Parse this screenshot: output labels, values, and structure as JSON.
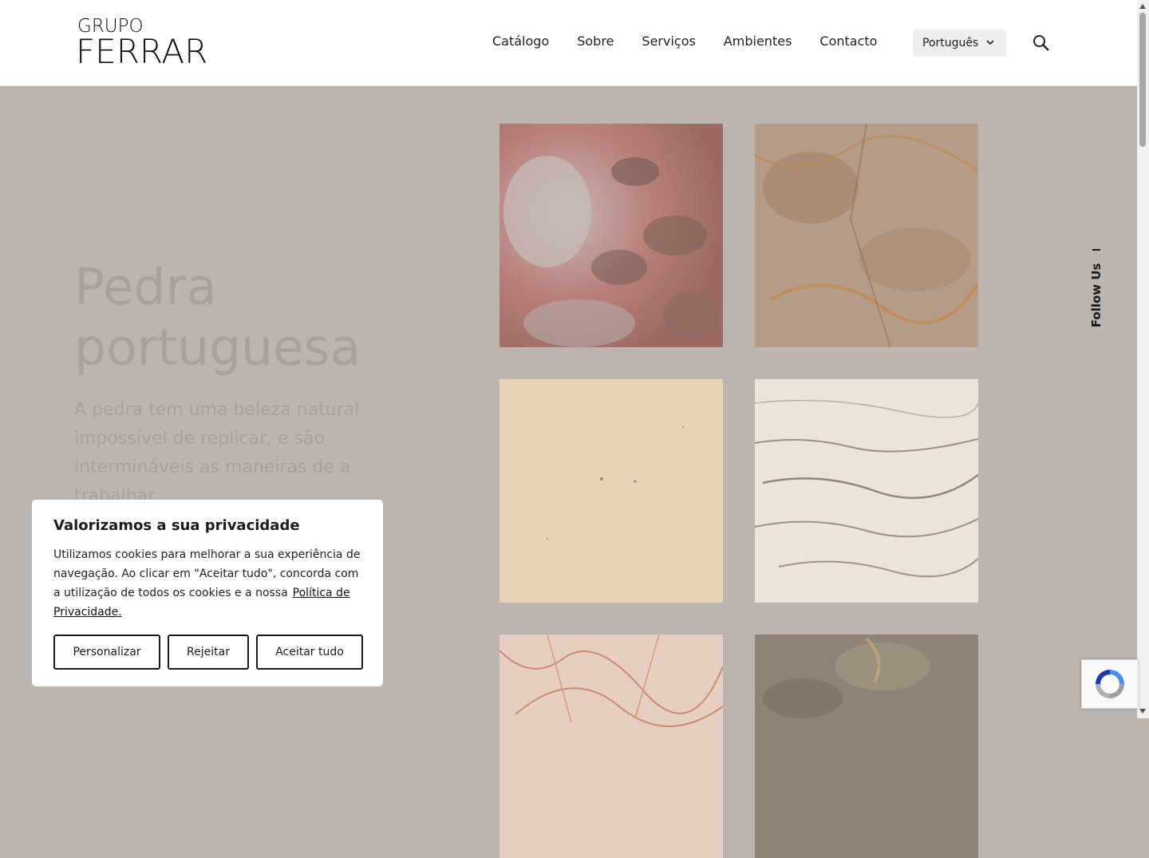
{
  "header": {
    "logo_small": "GRUPO",
    "logo_big": "FERRAR",
    "nav": [
      "Catálogo",
      "Sobre",
      "Serviços",
      "Ambientes",
      "Contacto"
    ],
    "language": "Português"
  },
  "hero": {
    "title_line1": "Pedra",
    "title_line2": "portuguesa",
    "text": "A pedra tem uma beleza natural impossível de replicar, e são intermináveis as maneiras de a trabalhar."
  },
  "follow": "Follow Us",
  "cookie": {
    "title": "Valorizamos a sua privacidade",
    "body": "Utilizamos cookies para melhorar a sua experiência de navegação. Ao clicar em \"Aceitar tudo\", concorda com a utilização de todos os cookies e a nossa",
    "link": "Política de Privacidade.",
    "btn_customize": "Personalizar",
    "btn_reject": "Rejeitar",
    "btn_accept": "Aceitar tudo"
  },
  "colors": {
    "hero_bg": "#bcb4ae",
    "title": "#aaa19b"
  }
}
